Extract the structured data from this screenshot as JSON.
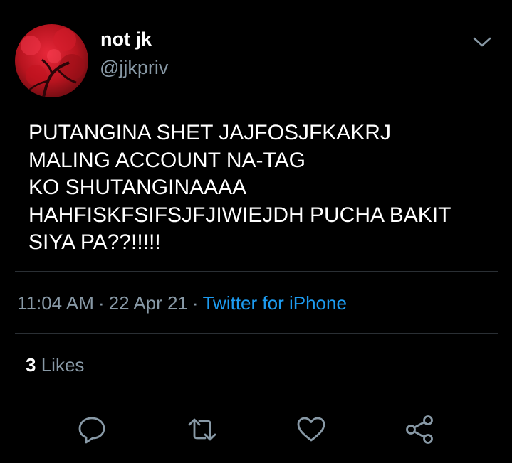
{
  "author": {
    "display_name": "not jk",
    "handle": "@jjkpriv",
    "avatar": "avatar-red-leaves"
  },
  "more_menu": {
    "icon": "chevron-down-icon"
  },
  "tweet": {
    "lines": [
      "PUTANGINA SHET JAJFOSJFKAKRJ",
      "MALING ACCOUNT NA-TAG",
      "KO SHUTANGINAAAA",
      "HAHFISKFSIFSJFJIWIEJDH PUCHA BAKIT",
      "SIYA PA??!!!!!"
    ]
  },
  "meta": {
    "time": "11:04 AM",
    "separator": "·",
    "date": "22 Apr 21",
    "source": "Twitter for iPhone"
  },
  "stats": {
    "likes_count": "3",
    "likes_label": "Likes"
  },
  "actions": [
    {
      "name": "reply",
      "icon": "reply-icon"
    },
    {
      "name": "retweet",
      "icon": "retweet-icon"
    },
    {
      "name": "like",
      "icon": "heart-icon"
    },
    {
      "name": "share",
      "icon": "share-icon"
    }
  ],
  "colors": {
    "background": "#000000",
    "text": "#ffffff",
    "secondary_text": "#8899a6",
    "link": "#1d9bf0",
    "divider": "#2a2f34",
    "icon": "#8899a6"
  }
}
